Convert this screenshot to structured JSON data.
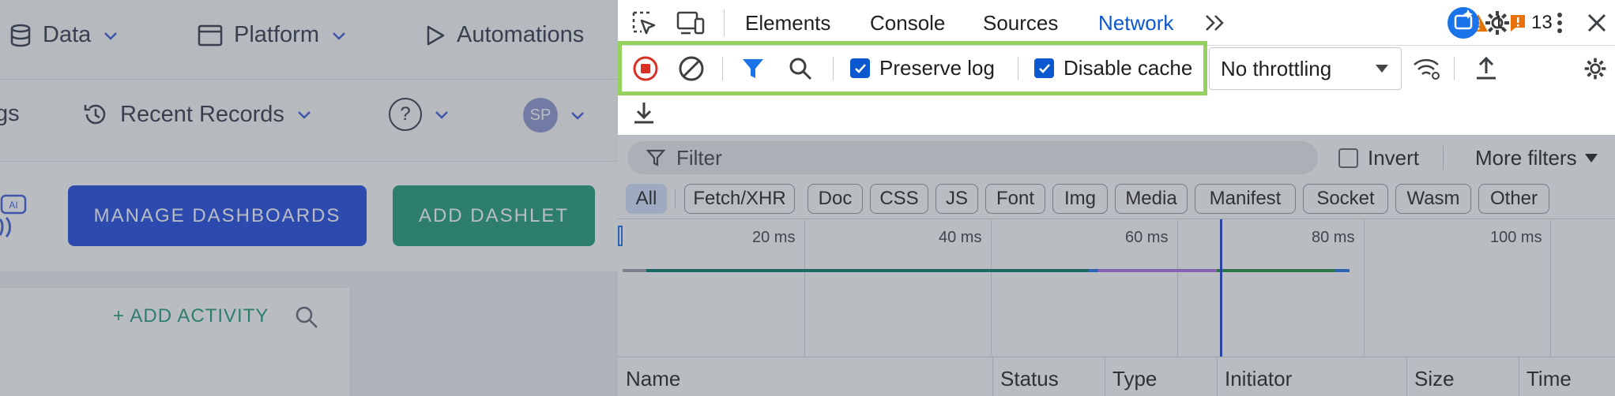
{
  "app": {
    "nav": {
      "data": "Data",
      "platform": "Platform",
      "automations": "Automations",
      "partial_left": "gs",
      "recent_records": "Recent Records",
      "help": "?",
      "avatar": "SP"
    },
    "manage_dashboards": "MANAGE DASHBOARDS",
    "add_dashlet": "ADD DASHLET",
    "add_activity": "+ ADD ACTIVITY",
    "ai_badge": "AI"
  },
  "devtools": {
    "tabs": [
      "Elements",
      "Console",
      "Sources",
      "Network"
    ],
    "active_tab": "Network",
    "warnings_count": "1",
    "issues_count": "13",
    "toolbar": {
      "preserve_log": "Preserve log",
      "disable_cache": "Disable cache",
      "throttling": "No throttling"
    },
    "filter": {
      "placeholder": "Filter",
      "invert": "Invert",
      "more_filters": "More filters"
    },
    "types": [
      "All",
      "Fetch/XHR",
      "Doc",
      "CSS",
      "JS",
      "Font",
      "Img",
      "Media",
      "Manifest",
      "Socket",
      "Wasm",
      "Other"
    ],
    "timeline_ticks": [
      "20 ms",
      "40 ms",
      "60 ms",
      "80 ms",
      "100 ms"
    ],
    "columns": [
      "Name",
      "Status",
      "Type",
      "Initiator",
      "Size",
      "Time"
    ]
  },
  "colors": {
    "accent_blue": "#0b57d0",
    "highlight_green": "#94d15e",
    "record_red": "#d93025",
    "warning_orange": "#e37400",
    "issue_orange": "#e8710a",
    "manage_button": "#1d48e2",
    "dashlet_button": "#1e9c78"
  }
}
